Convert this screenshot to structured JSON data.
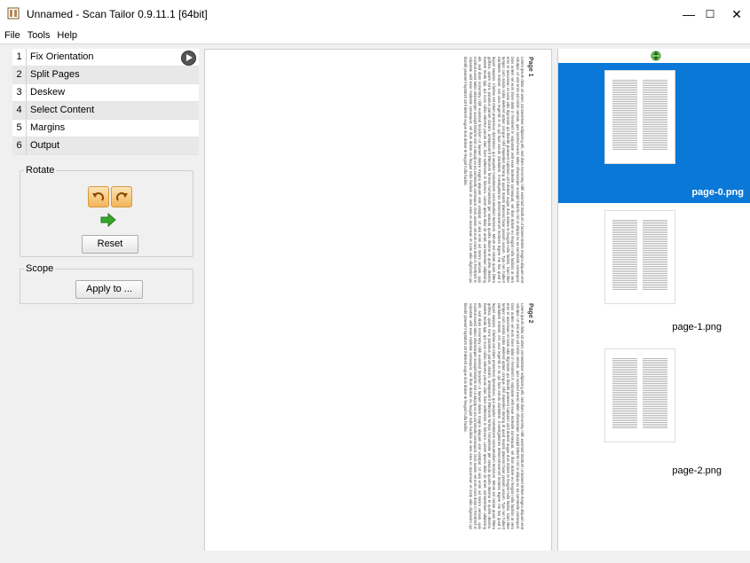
{
  "window": {
    "title": "Unnamed - Scan Tailor 0.9.11.1 [64bit]",
    "minimize": "—",
    "maximize": "☐",
    "close": "✕"
  },
  "menu": [
    "File",
    "Tools",
    "Help"
  ],
  "stages": [
    {
      "num": "1",
      "label": "Fix Orientation"
    },
    {
      "num": "2",
      "label": "Split Pages"
    },
    {
      "num": "3",
      "label": "Deskew"
    },
    {
      "num": "4",
      "label": "Select Content"
    },
    {
      "num": "5",
      "label": "Margins"
    },
    {
      "num": "6",
      "label": "Output"
    }
  ],
  "rotate": {
    "legend": "Rotate",
    "reset_label": "Reset"
  },
  "scope": {
    "legend": "Scope",
    "apply_label": "Apply to ..."
  },
  "document": {
    "page1": {
      "title": "Page 1",
      "text": "Lorem ipsum dolor sit amet, consectetuer adipiscing elit, sed diam nonummy nibh euismod tincidunt ut laoreet dolore magna aliquam erat volutpat. Ut wisi enim ad minim veniam, quis nostrud exerci tation ullamcorper suscipit lobortis nisl ut aliquip ex ea commodo consequat. Duis autem vel eum iriure dolor in hendrerit in vulputate velit esse molestie consequat, vel illum dolore eu feugiat nulla facilisis at vero eros et accumsan et iusto odio dignissim qui blandit praesent luptatum zzril delenit augue duis dolore te feugait nulla facilisi. Nam liber tempor cum soluta nobis eleifend option congue nihil imperdiet doming id quod mazim placerat facer possim assum. Typi non habent claritatem insitam; est usus legentis in iis qui facit eorum claritatem. Investigationes demonstraverunt lectores legere me lius quod ii legunt saepius. Claritas est etiam processus dynamicus, qui sequitur mutationem consuetudium lectorum. Mirum est notare quam littera gothica, quam nunc putamus parum claram, anteposuerit litterarum formas humanitatis per seacula quarta decima et quinta decima. Eodem modo typi, qui nunc nobis videntur parum clari, fiant sollemnes in futurum. Lorem ipsum dolor sit amet, consectetuer adipiscing elit, sed diam nonummy nibh euismod tincidunt ut laoreet dolore magna aliquam erat volutpat. Ut wisi enim ad minim veniam, quis nostrud exerci tation ullamcorper suscipit lobortis nisl ut aliquip ex ea commodo consequat. Duis autem vel eum iriure dolor in hendrerit in vulputate velit esse molestie consequat, vel illum dolore eu feugiat nulla facilisis at vero eros et accumsan et iusto odio dignissim qui blandit praesent luptatum zzril delenit augue duis dolore te feugait nulla facilisi."
    },
    "page2": {
      "title": "Page 2",
      "text": "Lorem ipsum dolor sit amet, consectetuer adipiscing elit, sed diam nonummy nibh euismod tincidunt ut laoreet dolore magna aliquam erat volutpat. Ut wisi enim ad minim veniam, quis nostrud exerci tation ullamcorper suscipit lobortis nisl ut aliquip ex ea commodo consequat. Duis autem vel eum iriure dolor in hendrerit in vulputate velit esse molestie consequat, vel illum dolore eu feugiat nulla facilisis at vero eros et accumsan et iusto odio dignissim qui blandit praesent luptatum zzril delenit augue duis dolore te feugait nulla facilisi. Nam liber tempor cum soluta nobis eleifend option congue nihil imperdiet doming id quod mazim placerat facer possim assum. Typi non habent claritatem insitam; est usus legentis in iis qui facit eorum claritatem. Investigationes demonstraverunt lectores legere me lius quod ii legunt saepius. Claritas est etiam processus dynamicus, qui sequitur mutationem consuetudium lectorum. Mirum est notare quam littera gothica, quam nunc putamus parum claram, anteposuerit litterarum formas humanitatis per seacula quarta decima et quinta decima. Eodem modo typi, qui nunc nobis videntur parum clari, fiant sollemnes in futurum. Lorem ipsum dolor sit amet, consectetuer adipiscing elit, sed diam nonummy nibh euismod tincidunt ut laoreet dolore magna aliquam erat volutpat. Ut wisi enim ad minim veniam, quis nostrud exerci tation ullamcorper suscipit lobortis nisl ut aliquip ex ea commodo consequat. Duis autem vel eum iriure dolor in hendrerit in vulputate velit esse molestie consequat, vel illum dolore eu feugiat nulla facilisis at vero eros et accumsan et iusto odio dignissim qui blandit praesent luptatum zzril delenit augue duis dolore te feugait nulla facilisi."
    }
  },
  "thumbnails": [
    {
      "name": "page-0.png",
      "selected": true
    },
    {
      "name": "page-1.png",
      "selected": false
    },
    {
      "name": "page-2.png",
      "selected": false
    }
  ],
  "colors": {
    "selection": "#0a78d7",
    "rotate_button": "#f4b45a",
    "arrow_green": "#3aa52c"
  },
  "icons": {
    "app": "scan-tailor-app-icon",
    "play": "play-icon",
    "rotate_left": "rotate-left-icon",
    "rotate_right": "rotate-right-icon",
    "arrow": "green-arrow-right-icon",
    "thumb_header": "fit-size-icon"
  }
}
